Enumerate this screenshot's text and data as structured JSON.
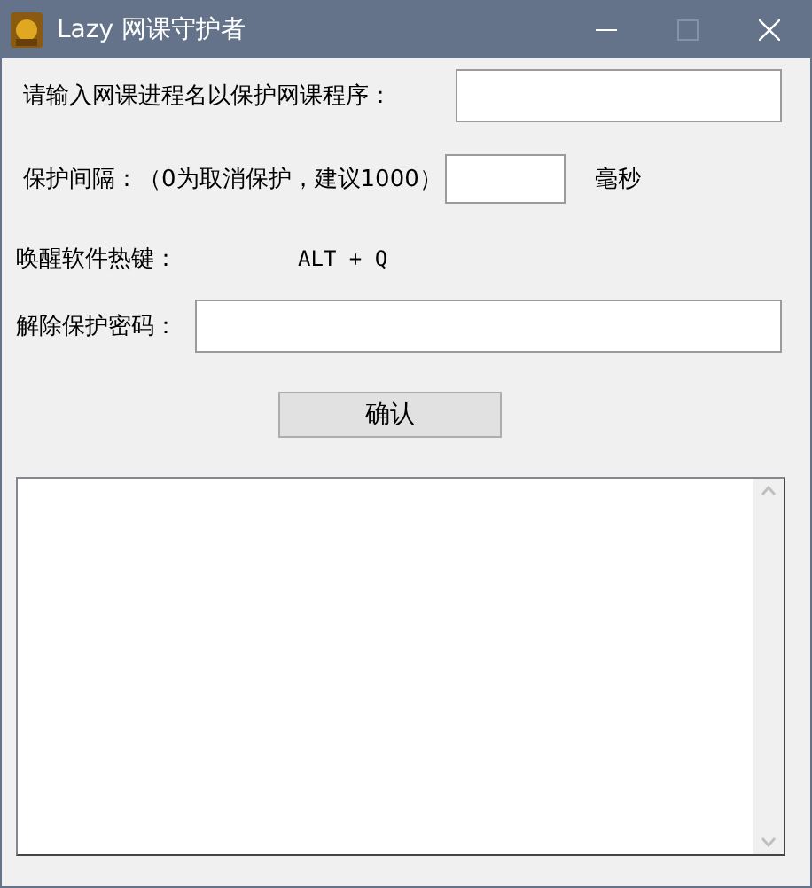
{
  "window": {
    "title": "Lazy 网课守护者",
    "maximize_disabled": true
  },
  "process_row": {
    "label": "请输入网课进程名以保护网课程序："
  },
  "interval_row": {
    "label": "保护间隔：（0为取消保护，建议1000）",
    "unit": "毫秒"
  },
  "hotkey_row": {
    "label": "唤醒软件热键：",
    "value": "ALT + Q"
  },
  "password_row": {
    "label": "解除保护密码："
  },
  "buttons": [
    "确认"
  ]
}
